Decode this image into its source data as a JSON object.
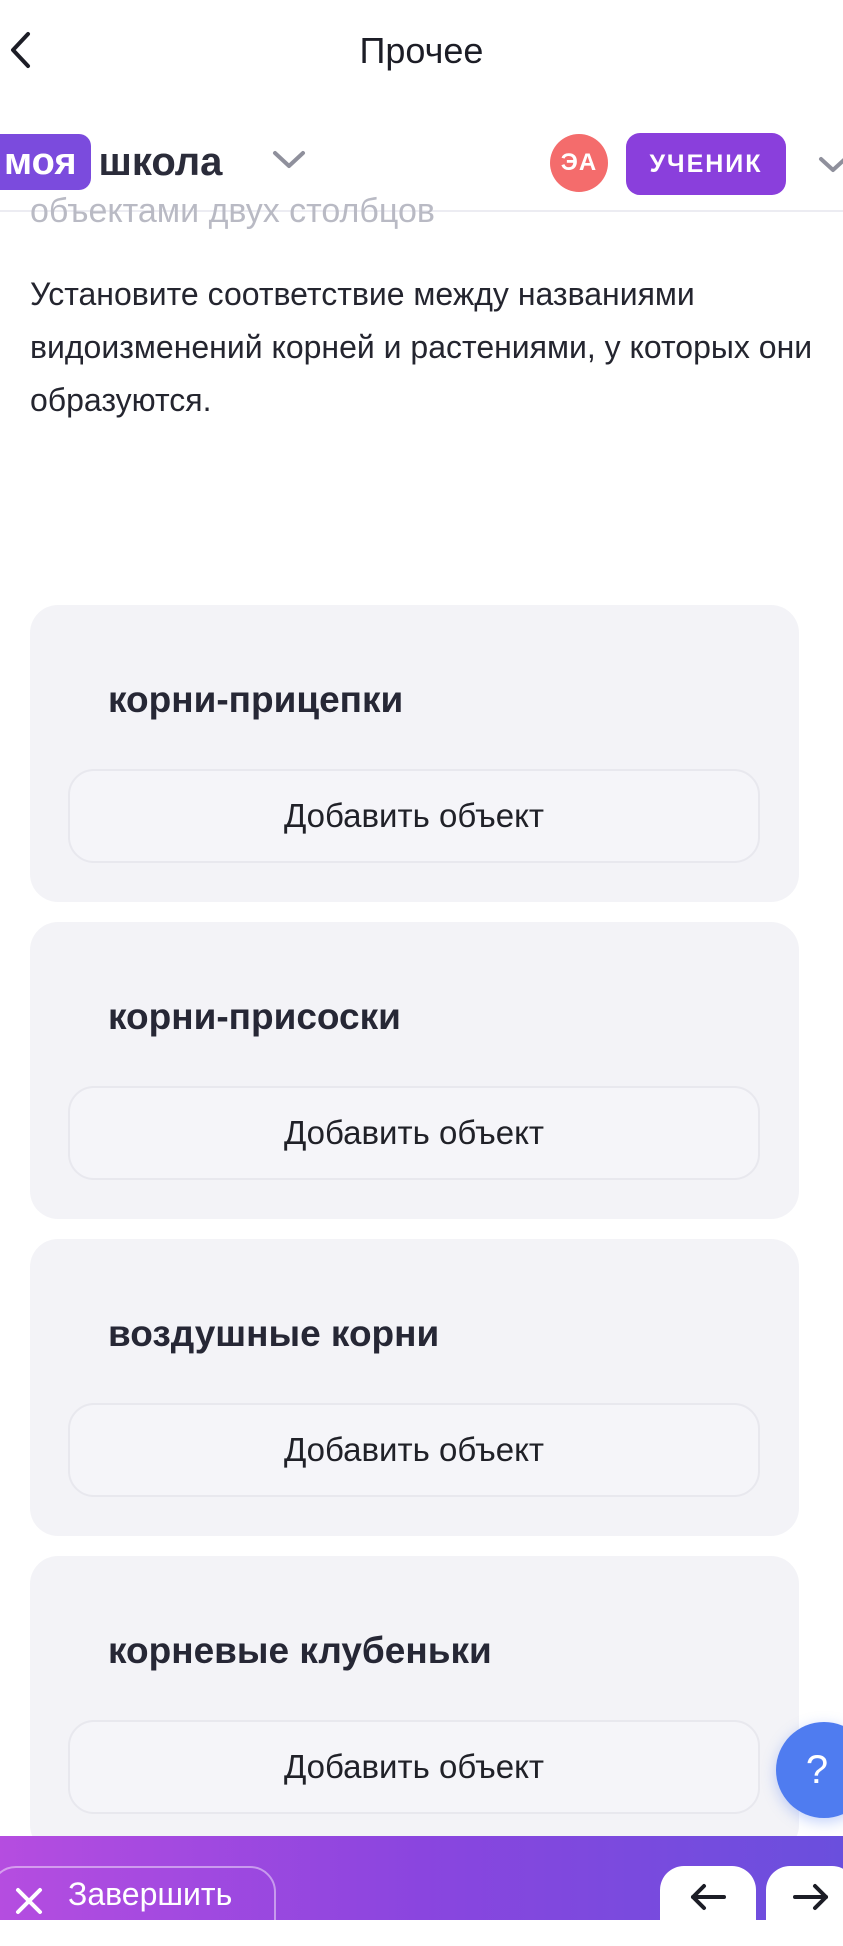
{
  "nav": {
    "title": "Прочее"
  },
  "header": {
    "logo_part1": "моя",
    "logo_part2": "школа",
    "avatar_initials": "ЭА",
    "role": "УЧЕНИК"
  },
  "task": {
    "cut_instruction": "объектами двух столбцов",
    "question": "Установите соответствие между названиями видоизменений корней и растениями, у которых они образуются.",
    "groups": [
      {
        "title": "корни-прицепки",
        "add_label": "Добавить объект"
      },
      {
        "title": "корни-присоски",
        "add_label": "Добавить объект"
      },
      {
        "title": "воздушные корни",
        "add_label": "Добавить объект"
      },
      {
        "title": "корневые клубеньки",
        "add_label": "Добавить объект"
      }
    ]
  },
  "help": {
    "label": "?"
  },
  "footer": {
    "finish_label": "Завершить"
  },
  "icons": {
    "back": "chevron-left-icon",
    "dropdown": "chevron-down-icon",
    "close": "close-icon",
    "prev": "arrow-left-icon",
    "next": "arrow-right-icon"
  },
  "colors": {
    "brand_purple": "#7b4bdd",
    "role_badge": "#8a3fdc",
    "avatar": "#f46c6c",
    "help": "#4f7cf0",
    "card_bg": "#f3f3f7"
  }
}
